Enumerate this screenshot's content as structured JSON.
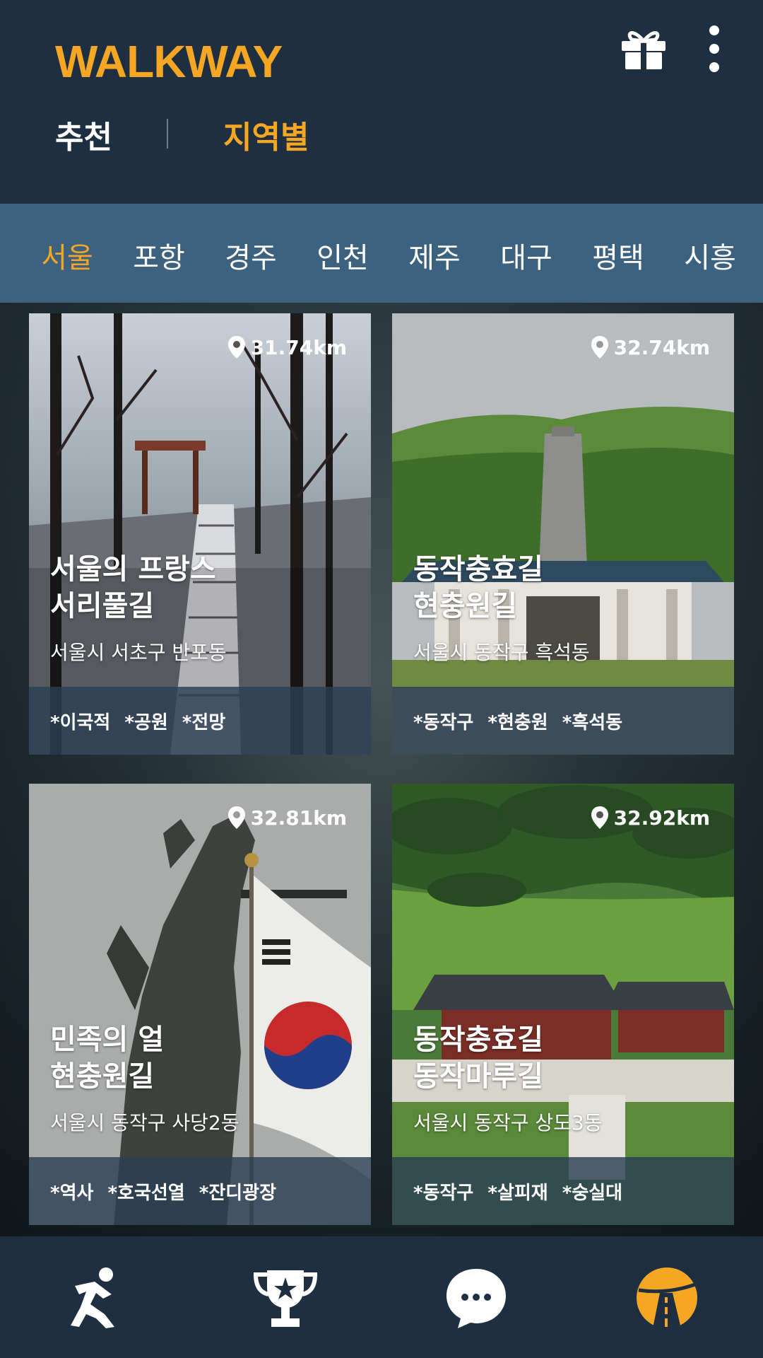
{
  "app": {
    "title": "WALKWAY"
  },
  "header": {
    "tabs": [
      {
        "label": "추천"
      },
      {
        "label": "지역별"
      }
    ],
    "active_tab": "지역별"
  },
  "regions": {
    "items": [
      "서울",
      "포항",
      "경주",
      "인천",
      "제주",
      "대구",
      "평택",
      "시흥"
    ],
    "active": "서울"
  },
  "cards": [
    {
      "distance": "31.74km",
      "title_line1": "서울의 프랑스",
      "title_line2": "서리풀길",
      "address": "서울시 서초구 반포동",
      "tags": [
        "*이국적",
        "*공원",
        "*전망"
      ]
    },
    {
      "distance": "32.74km",
      "title_line1": "동작충효길",
      "title_line2": "현충원길",
      "address": "서울시 동작구 흑석동",
      "tags": [
        "*동작구",
        "*현충원",
        "*흑석동"
      ]
    },
    {
      "distance": "32.81km",
      "title_line1": "민족의 얼",
      "title_line2": "현충원길",
      "address": "서울시 동작구 사당2동",
      "tags": [
        "*역사",
        "*호국선열",
        "*잔디광장"
      ]
    },
    {
      "distance": "32.92km",
      "title_line1": "동작충효길",
      "title_line2": "동작마루길",
      "address": "서울시 동작구 상도3동",
      "tags": [
        "*동작구",
        "*살피재",
        "*숭실대"
      ]
    }
  ],
  "icons": {
    "header": [
      "gift-icon",
      "more-vertical-icon"
    ],
    "bottom_nav": [
      "running-icon",
      "trophy-icon",
      "chat-icon",
      "road-icon"
    ],
    "card": "location-pin-icon"
  },
  "colors": {
    "accent": "#f5a623",
    "header_bg": "#1e2f42",
    "region_bar_bg": "#3d627f",
    "tag_bar_bg": "#2b4054"
  }
}
